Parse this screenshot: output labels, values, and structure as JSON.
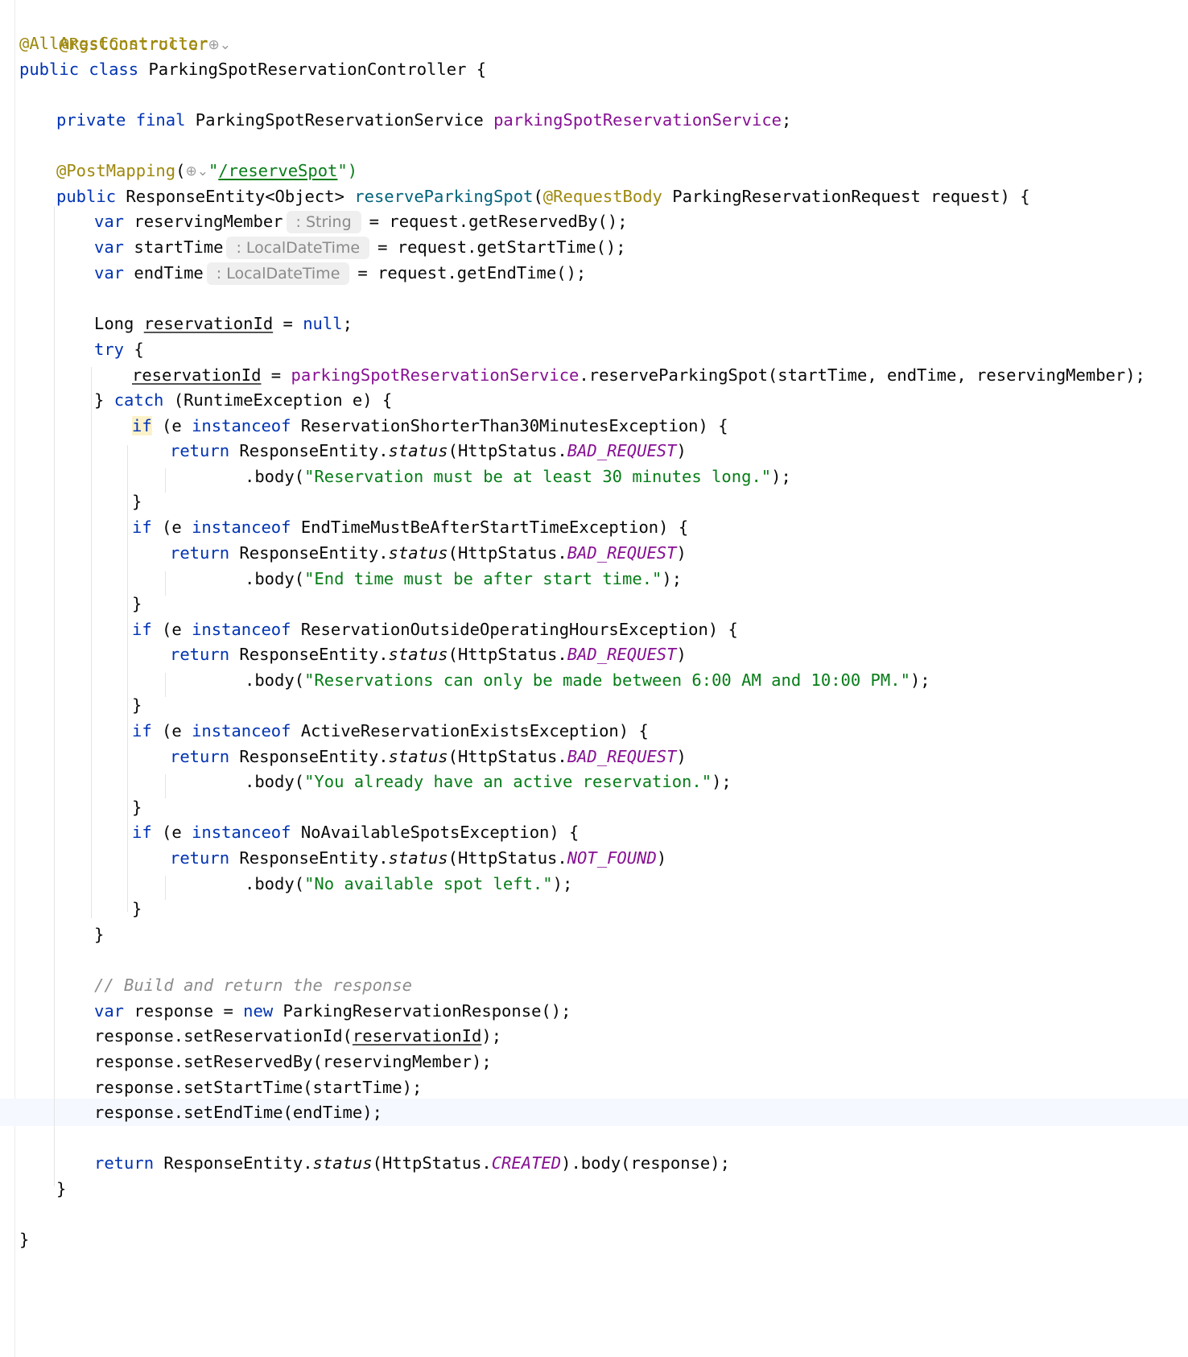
{
  "editor": {
    "annotations": {
      "rest_controller": "@RestController",
      "all_args": "@AllArgsConstructor",
      "post_mapping": "@PostMapping",
      "request_body": "@RequestBody"
    },
    "keywords": {
      "public": "public",
      "class": "class",
      "private": "private",
      "final": "final",
      "var": "var",
      "null": "null",
      "try": "try",
      "catch": "catch",
      "if": "if",
      "instanceof": "instanceof",
      "return": "return",
      "new": "new"
    },
    "punct": {
      "open_brace": "{",
      "close_brace": "}",
      "semicolon": ";",
      "open_paren": "(",
      "close_paren": ")",
      "quote": "\"",
      "at": "@",
      "eq_null": " = ",
      "try_open": " {",
      "catch_open": "} ",
      "catch_args": " (RuntimeException e) {",
      "if_open": " (e ",
      "dot": ".",
      "ret_tail": ".body(response);"
    },
    "class_decl": {
      "name": " ParkingSpotReservationController {"
    },
    "field_decl": {
      "type": " ParkingSpotReservationService ",
      "name": "parkingSpotReservationService",
      "end": ";"
    },
    "mapping": {
      "prefix": "(",
      "path": "/reserveSpot",
      "suffix": "\")"
    },
    "method_decl": {
      "ret": " ResponseEntity<Object> ",
      "name": "reserveParkingSpot",
      "open": "(",
      "param": " ParkingReservationRequest request) {"
    },
    "vars": [
      {
        "name": " reservingMember",
        "hint": ": String",
        "value": "= request.getReservedBy();"
      },
      {
        "name": " startTime",
        "hint": ": LocalDateTime",
        "value": "= request.getStartTime();"
      },
      {
        "name": " endTime",
        "hint": ": LocalDateTime",
        "value": "= request.getEndTime();"
      }
    ],
    "long_decl": {
      "type": "Long ",
      "name": "reservationId"
    },
    "assign": {
      "var": "reservationId",
      "mid": " = ",
      "svc": "parkingSpotReservationService",
      "call": ".reserveParkingSpot(startTime, endTime, reservingMember);"
    },
    "handlers": [
      {
        "exception": " ReservationShorterThan30MinutesException) {",
        "status_const": "BAD_REQUEST",
        "message": "\"Reservation must be at least 30 minutes long.\""
      },
      {
        "exception": " EndTimeMustBeAfterStartTimeException) {",
        "status_const": "BAD_REQUEST",
        "message": "\"End time must be after start time.\""
      },
      {
        "exception": " ReservationOutsideOperatingHoursException) {",
        "status_const": "BAD_REQUEST",
        "message": "\"Reservations can only be made between 6:00 AM and 10:00 PM.\""
      },
      {
        "exception": " ActiveReservationExistsException) {",
        "status_const": "BAD_REQUEST",
        "message": "\"You already have an active reservation.\""
      },
      {
        "exception": " NoAvailableSpotsException) {",
        "status_const": "NOT_FOUND",
        "message": "\"No available spot left.\""
      }
    ],
    "resp_pre": " ResponseEntity.",
    "status_method": "status",
    "status_open": "(HttpStatus.",
    "body_open": ".body(",
    "body_close": ");",
    "comment": "// Build and return the response",
    "response_decl": {
      "name": " response = ",
      "ctor": " ParkingReservationResponse();"
    },
    "setters": {
      "set_id_pre": "response.setReservationId(",
      "set_id_arg": "reservationId",
      "set_id_post": ");",
      "set_by": "response.setReservedBy(reservingMember);",
      "set_start": "response.setStartTime(startTime);",
      "set_end": "response.setEndTime(endTime);"
    },
    "final_status": "CREATED",
    "globe_glyph": "⊕⌄"
  }
}
